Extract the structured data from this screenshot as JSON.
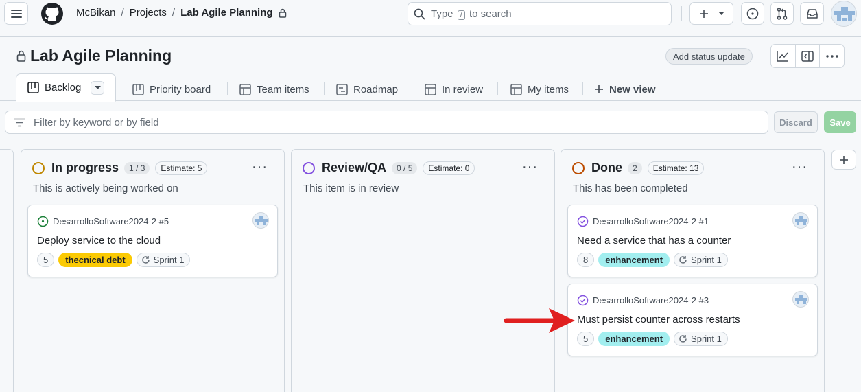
{
  "header": {
    "breadcrumb": [
      "McBikan",
      "Projects",
      "Lab Agile Planning"
    ],
    "search_placeholder_pre": "Type",
    "search_key": "/",
    "search_placeholder_post": "to search"
  },
  "project": {
    "title": "Lab Agile Planning",
    "status_update_label": "Add status update"
  },
  "tabs": [
    {
      "label": "Backlog",
      "icon": "board-icon"
    },
    {
      "label": "Priority board",
      "icon": "board-icon"
    },
    {
      "label": "Team items",
      "icon": "table-icon"
    },
    {
      "label": "Roadmap",
      "icon": "roadmap-icon"
    },
    {
      "label": "In review",
      "icon": "table-icon"
    },
    {
      "label": "My items",
      "icon": "table-icon"
    },
    {
      "label": "New view",
      "icon": "plus-icon"
    }
  ],
  "filter": {
    "placeholder": "Filter by keyword or by field",
    "discard_label": "Discard",
    "save_label": "Save"
  },
  "columns": [
    {
      "name": "In progress",
      "count": "1 / 3",
      "estimate": "Estimate: 5",
      "description": "This is actively being worked on",
      "color": "#bf8700",
      "cards": [
        {
          "repo": "DesarrolloSoftware2024-2 #5",
          "title": "Deploy service to the cloud",
          "points": "5",
          "label": "thecnical debt",
          "label_bg": "#fbca04",
          "label_fg": "#1f2328",
          "sprint": "Sprint 1",
          "state": "open"
        }
      ]
    },
    {
      "name": "Review/QA",
      "count": "0 / 5",
      "estimate": "Estimate: 0",
      "description": "This item is in review",
      "color": "#8250df",
      "cards": []
    },
    {
      "name": "Done",
      "count": "2",
      "estimate": "Estimate: 13",
      "description": "This has been completed",
      "color": "#bc4c00",
      "cards": [
        {
          "repo": "DesarrolloSoftware2024-2 #1",
          "title": "Need a service that has a counter",
          "points": "8",
          "label": "enhancement",
          "label_bg": "#a2eeef",
          "label_fg": "#1f2328",
          "sprint": "Sprint 1",
          "state": "closed"
        },
        {
          "repo": "DesarrolloSoftware2024-2 #3",
          "title": "Must persist counter across restarts",
          "points": "5",
          "label": "enhancement",
          "label_bg": "#a2eeef",
          "label_fg": "#1f2328",
          "sprint": "Sprint 1",
          "state": "closed"
        }
      ]
    }
  ],
  "colors": {
    "open": "#1a7f37",
    "closed": "#8250df",
    "annotation_arrow": "#e02020"
  }
}
